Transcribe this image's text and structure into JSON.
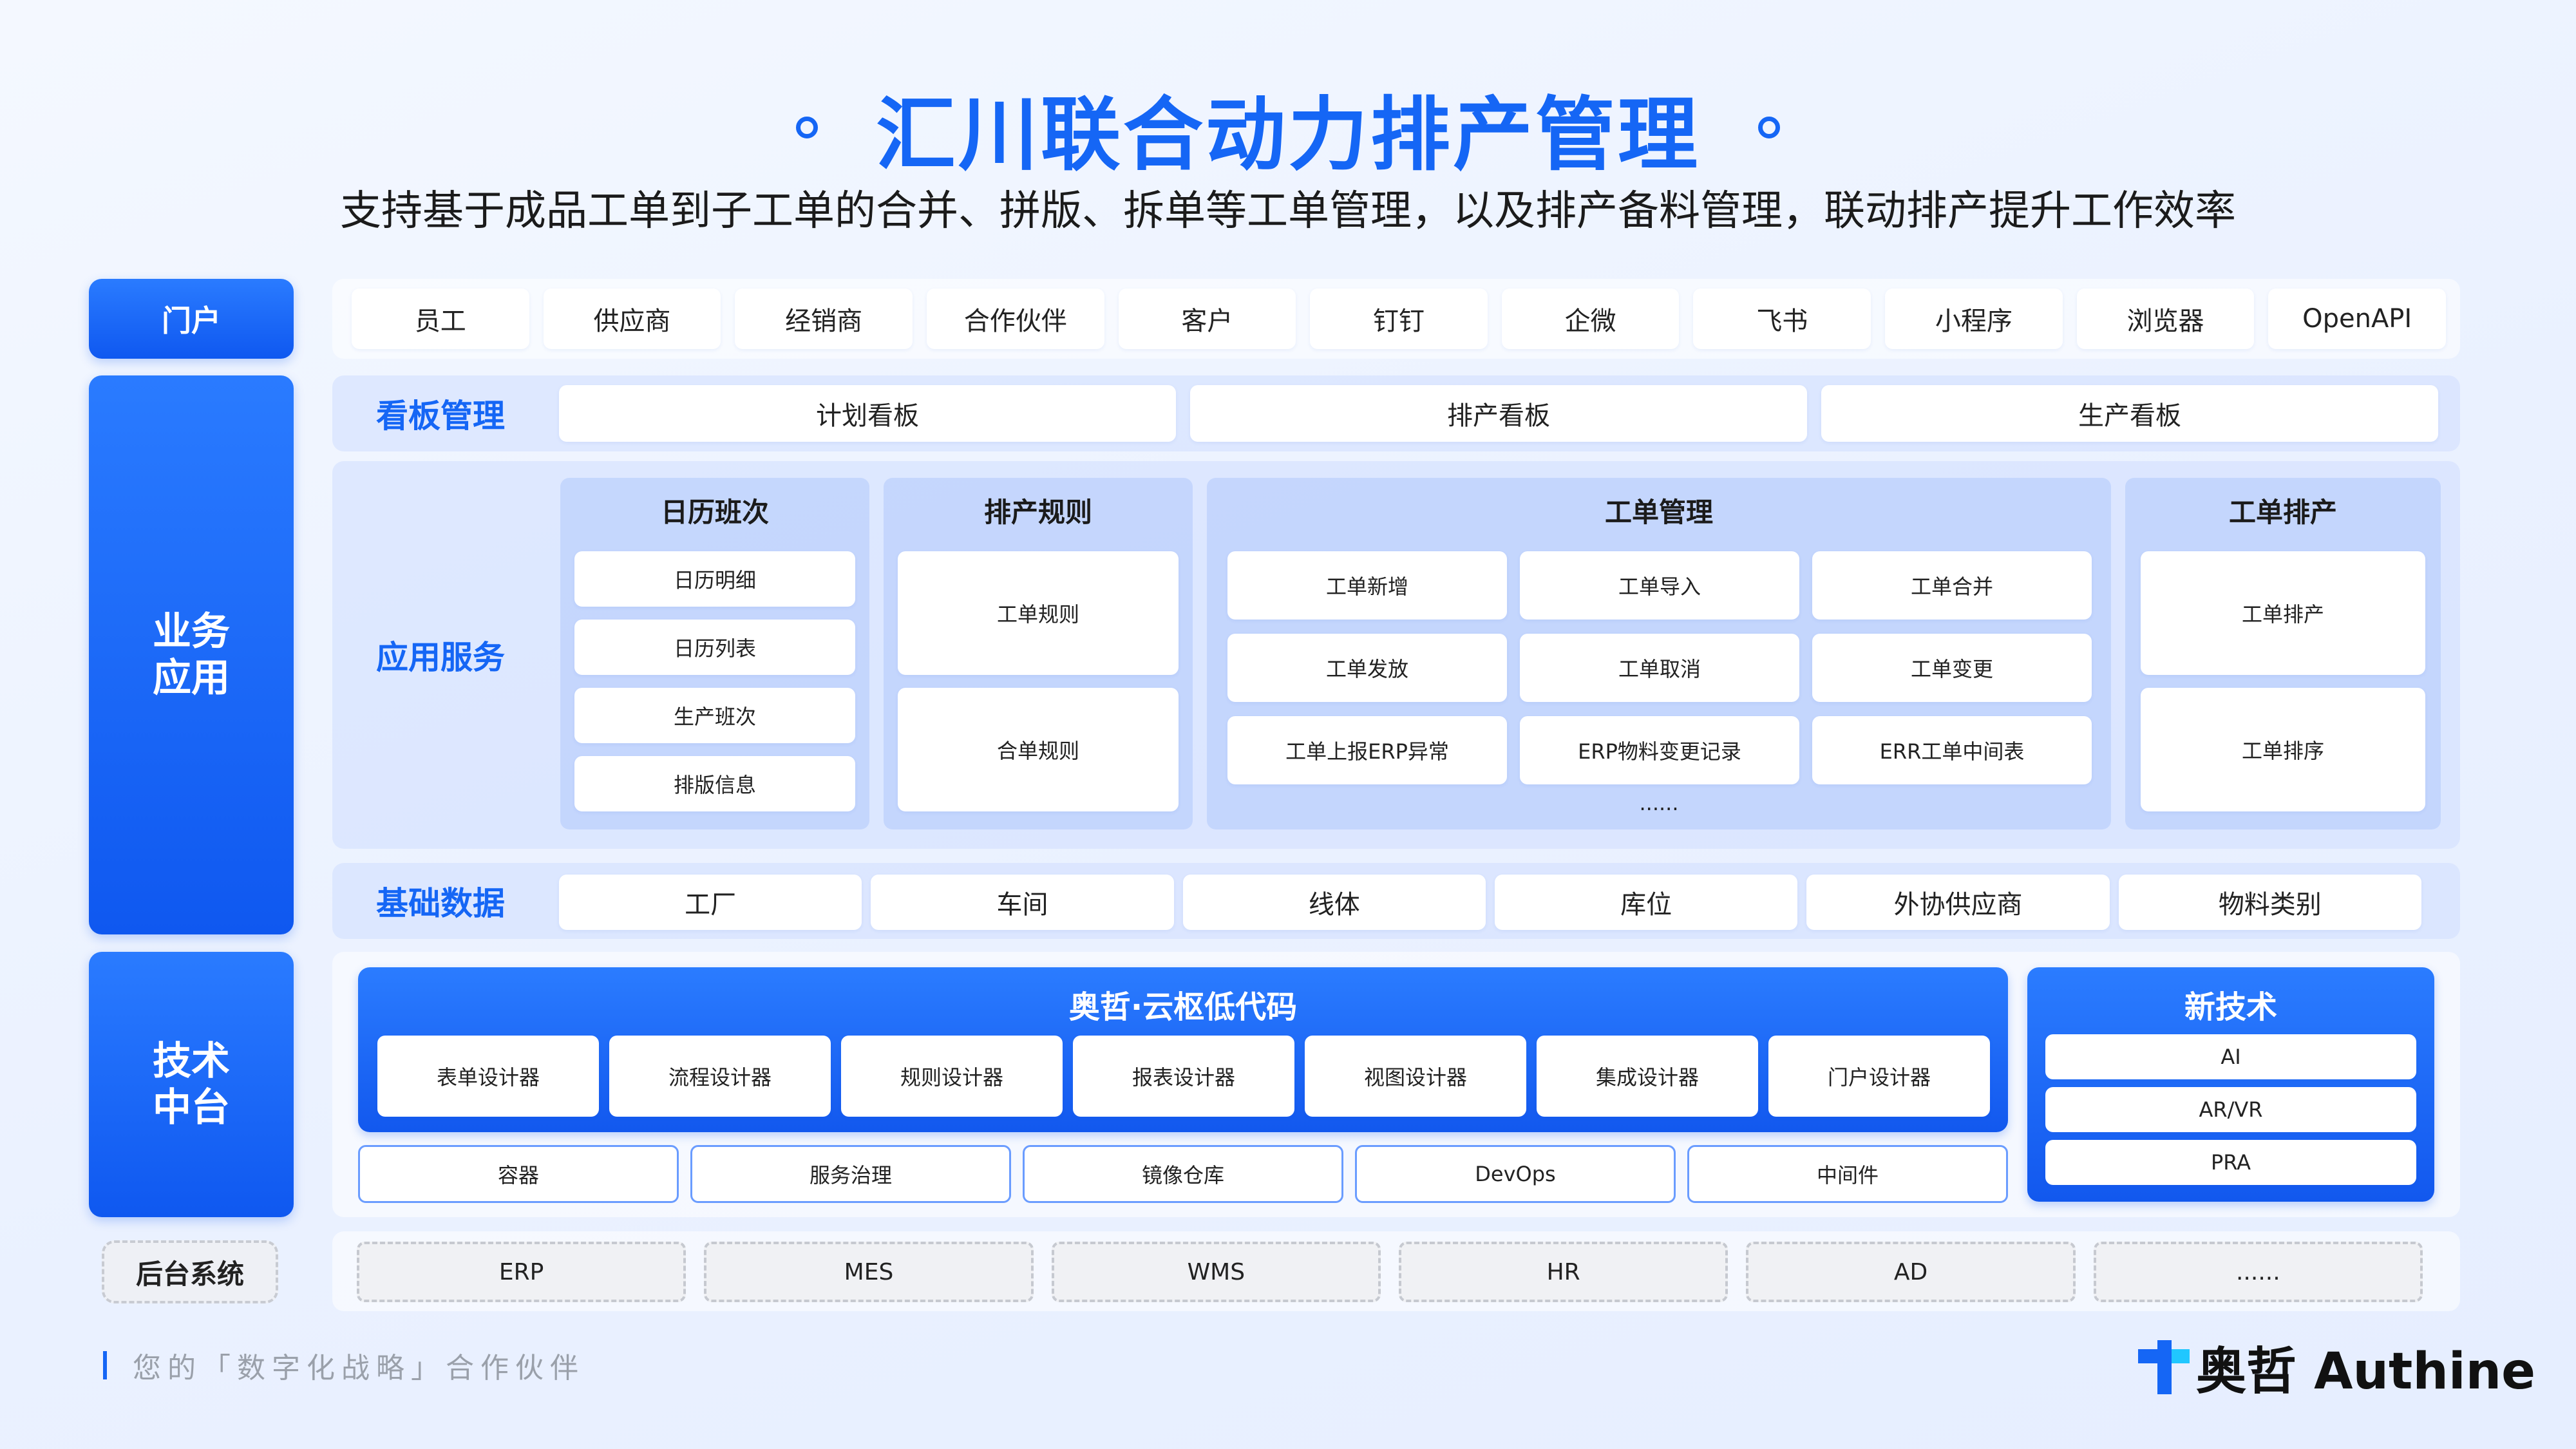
{
  "title": "汇川联合动力排产管理",
  "subtitle": "支持基于成品工单到子工单的合并、拼版、拆单等工单管理，以及排产备料管理，联动排产提升工作效率",
  "sidebar": {
    "portal": "门户",
    "business": "业务\n应用",
    "tech": "技术\n中台",
    "backend": "后台系统"
  },
  "portal_items": [
    "员工",
    "供应商",
    "经销商",
    "合作伙伴",
    "客户",
    "钉钉",
    "企微",
    "飞书",
    "小程序",
    "浏览器",
    "OpenAPI"
  ],
  "board": {
    "label": "看板管理",
    "items": [
      "计划看板",
      "排产看板",
      "生产看板"
    ]
  },
  "app_services": {
    "label": "应用服务",
    "calendar": {
      "title": "日历班次",
      "items": [
        "日历明细",
        "日历列表",
        "生产班次",
        "排版信息"
      ]
    },
    "rules": {
      "title": "排产规则",
      "items": [
        "工单规则",
        "合单规则"
      ]
    },
    "workorder": {
      "title": "工单管理",
      "items": [
        "工单新增",
        "工单导入",
        "工单合并",
        "工单发放",
        "工单取消",
        "工单变更",
        "工单上报ERP异常",
        "ERP物料变更记录",
        "ERR工单中间表"
      ],
      "more": "......"
    },
    "scheduling": {
      "title": "工单排产",
      "items": [
        "工单排产",
        "工单排序"
      ]
    }
  },
  "base_data": {
    "label": "基础数据",
    "items": [
      "工厂",
      "车间",
      "线体",
      "库位",
      "外协供应商",
      "物料类别"
    ]
  },
  "lowcode": {
    "title": "奥哲·云枢低代码",
    "items": [
      "表单设计器",
      "流程设计器",
      "规则设计器",
      "报表设计器",
      "视图设计器",
      "集成设计器",
      "门户设计器"
    ]
  },
  "infra": [
    "容器",
    "服务治理",
    "镜像仓库",
    "DevOps",
    "中间件"
  ],
  "newtech": {
    "title": "新技术",
    "items": [
      "AI",
      "AR/VR",
      "PRA"
    ]
  },
  "backend_items": [
    "ERP",
    "MES",
    "WMS",
    "HR",
    "AD",
    "......"
  ],
  "footer": "您的「数字化战略」合作伙伴",
  "logo": "奥哲 Authine",
  "colors": {
    "accent": "#1566f5",
    "panel": "#d2e0ff"
  }
}
